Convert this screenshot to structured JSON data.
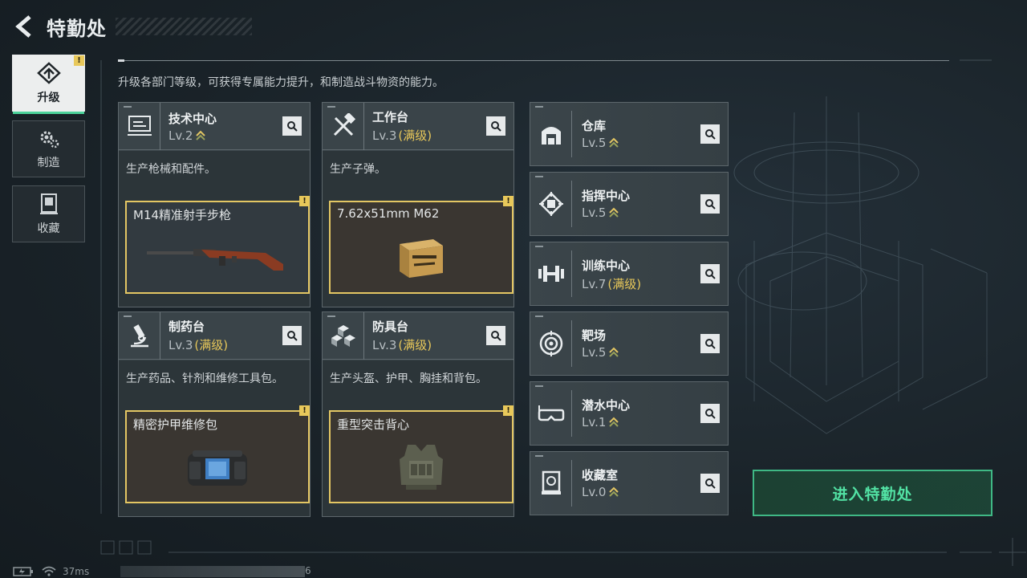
{
  "header": {
    "title": "特勤处",
    "back_icon": "back-chevron-icon"
  },
  "side_tabs": [
    {
      "label": "升级",
      "icon": "upgrade-arrow-icon",
      "active": true,
      "alert": "!"
    },
    {
      "label": "制造",
      "icon": "gears-icon",
      "active": false
    },
    {
      "label": "收藏",
      "icon": "collection-icon",
      "active": false
    }
  ],
  "description": "升级各部门等级，可获得专属能力提升，和制造战斗物资的能力。",
  "facilities": [
    {
      "name": "技术中心",
      "level": "Lv.2",
      "max": "",
      "production": "生产枪械和配件。",
      "item": "M14精准射手步枪",
      "item_alert": "!",
      "icon": "tech-center-icon",
      "item_image": "rifle-image"
    },
    {
      "name": "工作台",
      "level": "Lv.3",
      "max": "(满级)",
      "production": "生产子弹。",
      "item": "7.62x51mm M62",
      "item_alert": "!",
      "icon": "workbench-tools-icon",
      "item_image": "ammo-box-image"
    },
    {
      "name": "制药台",
      "level": "Lv.3",
      "max": "(满级)",
      "production": "生产药品、针剂和维修工具包。",
      "item": "精密护甲维修包",
      "item_alert": "!",
      "icon": "microscope-icon",
      "item_image": "repair-kit-image"
    },
    {
      "name": "防具台",
      "level": "Lv.3",
      "max": "(满级)",
      "production": "生产头盔、护甲、胸挂和背包。",
      "item": "重型突击背心",
      "item_alert": "!",
      "icon": "armor-blocks-icon",
      "item_image": "vest-image"
    }
  ],
  "departments": [
    {
      "name": "仓库",
      "level": "Lv.5",
      "max": "",
      "icon": "warehouse-icon"
    },
    {
      "name": "指挥中心",
      "level": "Lv.5",
      "max": "",
      "icon": "command-chip-icon"
    },
    {
      "name": "训练中心",
      "level": "Lv.7",
      "max": "(满级)",
      "icon": "dumbbell-icon"
    },
    {
      "name": "靶场",
      "level": "Lv.5",
      "max": "",
      "icon": "target-icon"
    },
    {
      "name": "潜水中心",
      "level": "Lv.1",
      "max": "",
      "icon": "diving-mask-icon"
    },
    {
      "name": "收藏室",
      "level": "Lv.0",
      "max": "",
      "icon": "display-case-icon"
    }
  ],
  "enter_button": "进入特勤处",
  "status_bar": {
    "ping": "37ms",
    "trailing": "6"
  },
  "colors": {
    "accent_green": "#52e2a4",
    "highlight_gold": "#e3c663",
    "panel": "#3a4449"
  }
}
